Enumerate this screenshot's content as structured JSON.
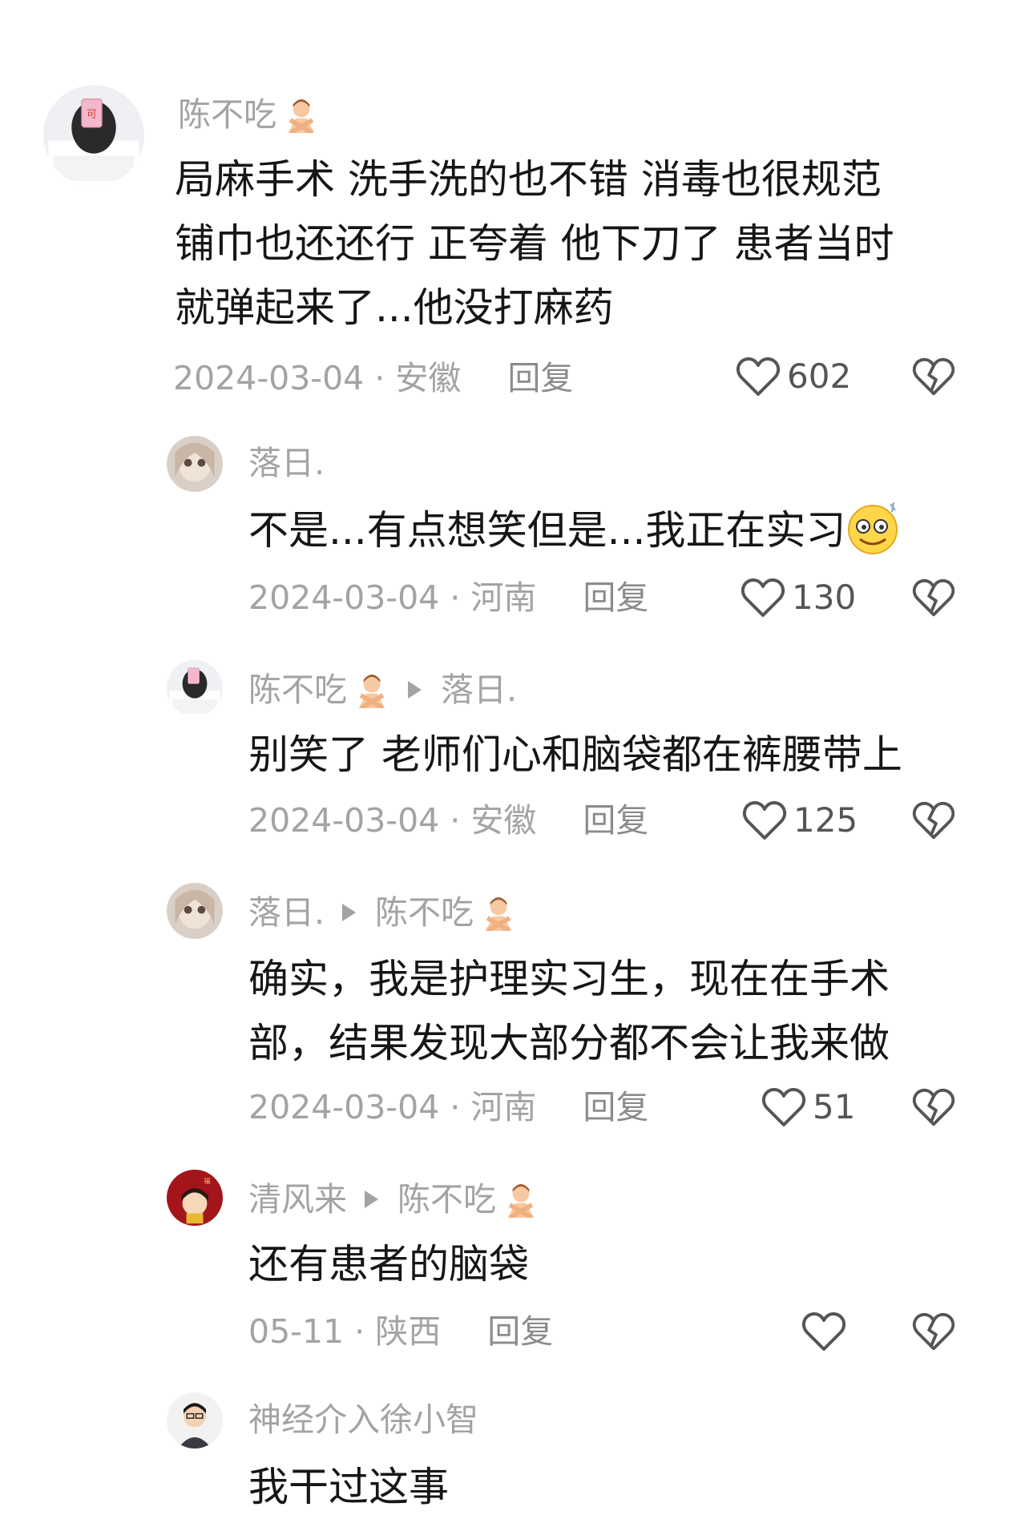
{
  "comments": [
    {
      "user": "陈不吃",
      "lines": [
        "局麻手术  洗手洗的也不错   消毒也很规范",
        "铺巾也还还行  正夸着  他下刀了   患者当时",
        "就弹起来了...他没打麻药"
      ],
      "meta": "2024-03-04 · 安徽",
      "reply": "回复",
      "likes": "602"
    },
    {
      "user": "落日.",
      "lines": [
        "不是...有点想笑但是...我正在实习"
      ],
      "meta": "2024-03-04 · 河南",
      "reply": "回复",
      "likes": "130"
    },
    {
      "user": "陈不吃",
      "reply_to": "落日.",
      "lines": [
        "别笑了   老师们心和脑袋都在裤腰带上"
      ],
      "meta": "2024-03-04 · 安徽",
      "reply": "回复",
      "likes": "125"
    },
    {
      "user": "落日.",
      "reply_to": "陈不吃",
      "lines": [
        "确实，我是护理实习生，现在在手术",
        "部，结果发现大部分都不会让我来做"
      ],
      "meta": "2024-03-04 · 河南",
      "reply": "回复",
      "likes": "51"
    },
    {
      "user": "清风来",
      "reply_to": "陈不吃",
      "lines": [
        "还有患者的脑袋"
      ],
      "meta": "05-11 · 陕西",
      "reply": "回复",
      "likes": ""
    },
    {
      "user": "神经介入徐小智",
      "lines": [
        "我干过这事"
      ]
    }
  ],
  "icons": {
    "like": "heart-outline-icon",
    "dislike": "broken-heart-icon",
    "reply_arrow": "triangle-right-icon",
    "user_emoji": "person-gesturing-no-emoji",
    "inline_emoji": "smiling-dizzy-emoji"
  },
  "colors": {
    "muted_text": "#a3a3a3",
    "body_text": "#161616",
    "icon": "#555555"
  }
}
